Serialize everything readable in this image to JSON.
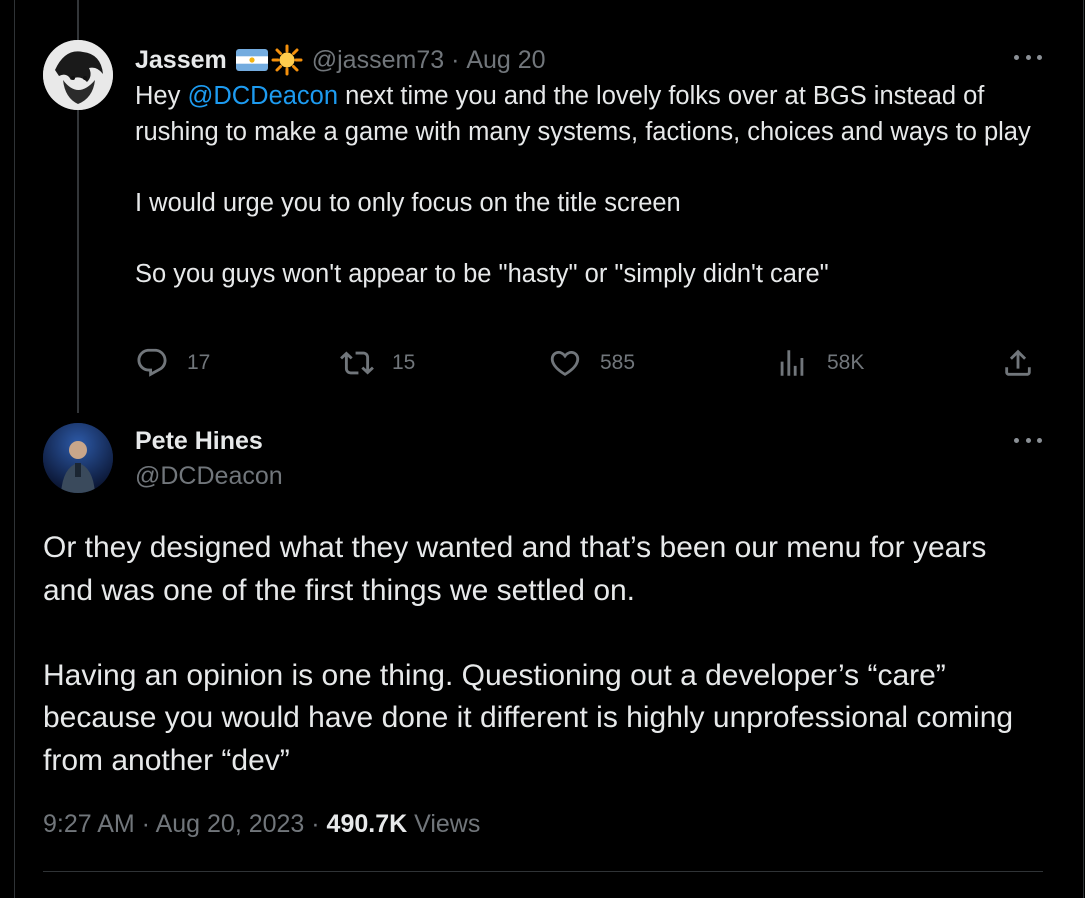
{
  "tweet1": {
    "name": "Jassem",
    "flag_emoji": "🇦🇷",
    "sun_emoji": "🌟",
    "handle": "@jassem73",
    "separator": " · ",
    "date": "Aug 20",
    "text": {
      "prefix": "Hey ",
      "mention": "@DCDeacon",
      "line1_rest": " next time you and the lovely folks over at BGS instead of rushing to make a game with many systems, factions, choices and ways to play",
      "para2": "I would urge you to only focus on the title screen",
      "para3": "So you guys won't appear to be \"hasty\" or \"simply didn't care\""
    },
    "actions": {
      "replies": "17",
      "retweets": "15",
      "likes": "585",
      "views": "58K"
    },
    "icons": {
      "reply": "reply-icon",
      "retweet": "retweet-icon",
      "like": "heart-icon",
      "views": "views-icon",
      "share": "share-icon",
      "more": "more-icon"
    }
  },
  "tweet2": {
    "name": "Pete Hines",
    "handle": "@DCDeacon",
    "para1": "Or they designed what they wanted and that’s been our menu for years and was one of the first things we settled on.",
    "para2": "Having an opinion is one thing. Questioning out a developer’s “care” because you would have done it different is highly unprofessional coming from another “dev”",
    "time": "9:27 AM",
    "separator": " · ",
    "date": "Aug 20, 2023",
    "separator2": " · ",
    "views_count": "490.7K",
    "views_label": " Views"
  },
  "colors": {
    "background": "#000000",
    "text": "#e7e9ea",
    "muted": "#71767b",
    "link": "#1d9bf0",
    "border": "#2f3336"
  }
}
